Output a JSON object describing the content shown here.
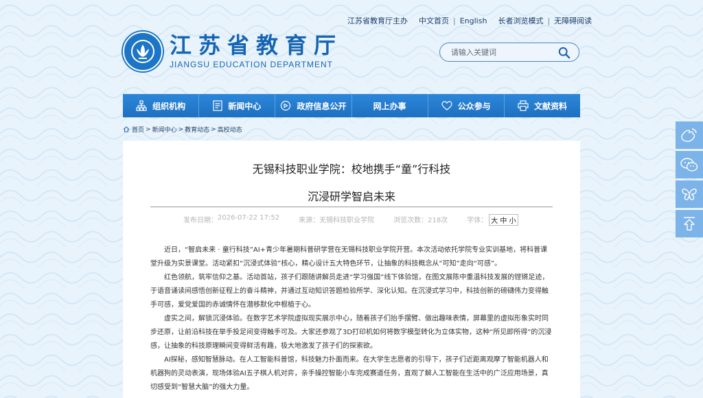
{
  "top_links": {
    "sponsor": "江苏省教育厅主办",
    "chinese_home": "中文首页",
    "english": "English",
    "elder_mode": "长者浏览模式",
    "accessible": "无障碍阅读"
  },
  "logo": {
    "cn": "江苏省教育厅",
    "en": "JIANGSU EDUCATION DEPARTMENT"
  },
  "search": {
    "placeholder": "请输入关键词"
  },
  "nav": [
    {
      "label": "组织机构",
      "icon": "org-chart-icon"
    },
    {
      "label": "新闻中心",
      "icon": "document-icon"
    },
    {
      "label": "政府信息公开",
      "icon": "eye-icon"
    },
    {
      "label": "网上办事",
      "icon": ""
    },
    {
      "label": "公众参与",
      "icon": "heart-icon"
    },
    {
      "label": "文献资料",
      "icon": "printer-icon"
    }
  ],
  "breadcrumb": [
    "首页",
    "新闻中心",
    "教育动态",
    "高校动态"
  ],
  "article": {
    "title_line1": "无锡科技职业学院：校地携手“童”行科技",
    "title_line2": "沉浸研学智启未来",
    "date_label": "发布日期：",
    "date_value": "2026-07-22 17:52",
    "source_label": "来源：",
    "source_value": "无锡科技职业学院",
    "views_label": "浏览次数：",
    "views_value": "218次",
    "fontsize_label": "字体：",
    "font_big": "大",
    "font_mid": "中",
    "font_small": "小",
    "paragraphs": [
      "近日，“智启未来 · 童行科技”AI+青少年暑期科普研学营在无锡科技职业学院开营。本次活动依托学院专业实训基地，将科普课堂升级为实景课堂。活动紧扣“沉浸式体验”核心，精心设计五大特色环节，让抽象的科技概念从“可知”走向“可感”。",
      "红色领航，筑牢信仰之基。活动首站，孩子们跟随讲解员走进“学习强国”线下体验馆，在图文展陈中重温科技发展的铿锵足迹，于语音诵读间感悟创新征程上的奋斗精神，并通过互动知识答题检验所学、深化认知。在沉浸式学习中，科技创新的磅礴伟力变得触手可感，爱党爱国的赤诚情怀在潜移默化中根植于心。",
      "虚实之间，解锁沉浸体验。在数字艺术学院虚拟现实展示中心，随着孩子们抬手摆臂、做出趣味表情，屏幕里的虚拟形象实时同步还原，让前沿科技在举手投足间变得触手可及。大家还参观了3D打印机如何将数字模型转化为立体实物，这种“所见即所得”的沉浸感，让抽象的科技原理瞬间变得鲜活有趣，极大地激发了孩子们的探索欲。",
      "AI探秘，感知智慧脉动。在人工智能科普馆，科技魅力扑面而来。在大学生志愿者的引导下，孩子们近距离观摩了智能机器人和机器狗的灵动表演，现场体验AI五子棋人机对弈，亲手操控智能小车完成赛道任务，直观了解人工智能在生活中的广泛应用场景，真切感受到“智慧大脑”的强大力量。"
    ]
  },
  "side_buttons": [
    "weibo-icon",
    "wechat-icon",
    "butterfly-icon",
    "back-to-top-icon"
  ],
  "colors": {
    "nav_blue": "#1e6fc0",
    "brand_blue": "#1565b3",
    "side_blue": "#7cb3e8"
  }
}
